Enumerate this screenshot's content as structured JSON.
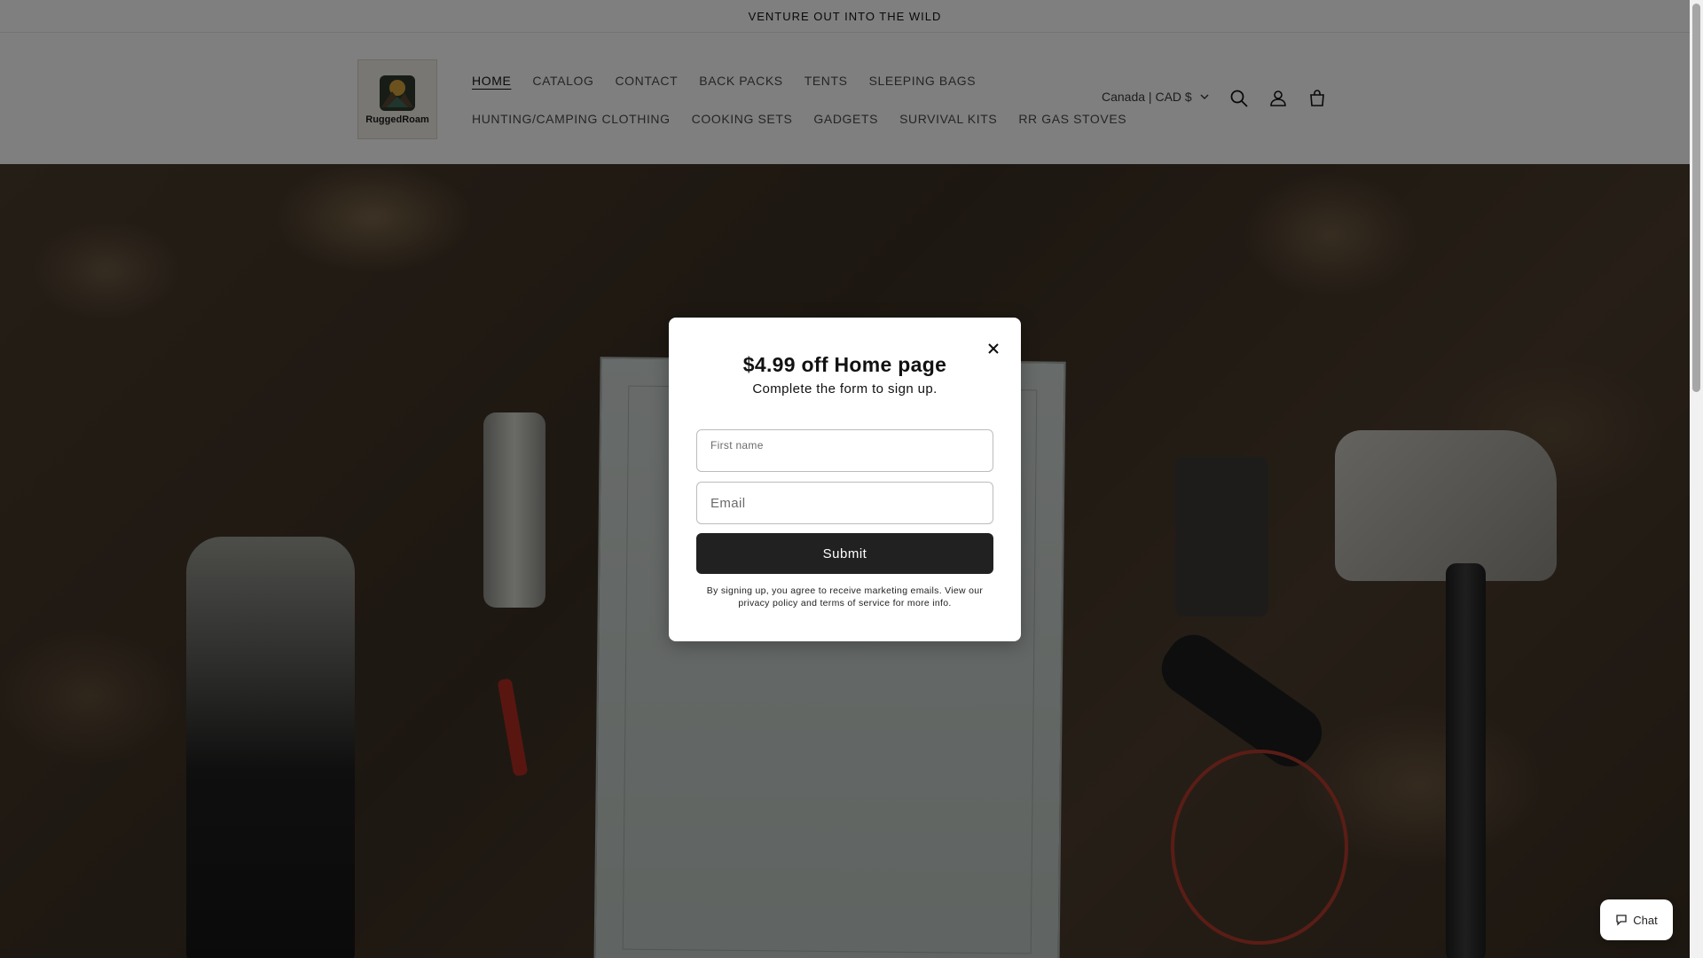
{
  "announcement": {
    "text": "VENTURE OUT INTO THE WILD"
  },
  "header": {
    "logo_text": "RuggedRoam",
    "nav_row1": [
      {
        "label": "HOME",
        "active": true
      },
      {
        "label": "CATALOG"
      },
      {
        "label": "CONTACT"
      },
      {
        "label": "BACK PACKS"
      },
      {
        "label": "TENTS"
      },
      {
        "label": "SLEEPING BAGS"
      }
    ],
    "nav_row2": [
      {
        "label": "HUNTING/CAMPING CLOTHING"
      },
      {
        "label": "COOKING SETS"
      },
      {
        "label": "GADGETS"
      },
      {
        "label": "SURVIVAL KITS"
      },
      {
        "label": "RR GAS STOVES"
      }
    ],
    "country_selector": "Canada | CAD $",
    "icons": [
      "search-icon",
      "account-icon",
      "cart-icon"
    ]
  },
  "modal": {
    "title": "$4.99 off Home page",
    "subtitle": "Complete the form to sign up.",
    "first_name_label": "First name",
    "email_placeholder": "Email",
    "submit_label": "Submit",
    "disclaimer": "By signing up, you agree to receive marketing emails. View our privacy policy and terms of service for more info."
  },
  "chat": {
    "label": "Chat"
  }
}
